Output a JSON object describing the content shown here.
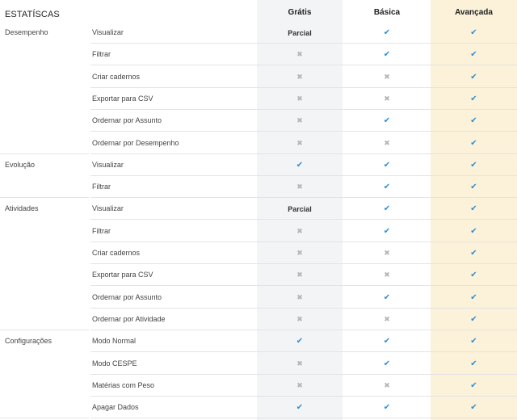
{
  "header": {
    "title": "ESTATÍSCAS",
    "plans": [
      "Grátis",
      "Básica",
      "Avançada"
    ]
  },
  "colors": {
    "check": "#2b8fd6",
    "cross": "#b5b5b5",
    "gratis_bg": "#f3f4f6",
    "avancada_bg": "#fcf1d9"
  },
  "icons": {
    "yes": "checkmark-icon",
    "no": "cross-icon"
  },
  "rows": [
    {
      "category": "Desempenho",
      "feature": "Visualizar",
      "values": [
        "Parcial",
        "yes",
        "yes"
      ]
    },
    {
      "category": "",
      "feature": "Filtrar",
      "values": [
        "no",
        "yes",
        "yes"
      ]
    },
    {
      "category": "",
      "feature": "Criar cadernos",
      "values": [
        "no",
        "no",
        "yes"
      ]
    },
    {
      "category": "",
      "feature": "Exportar para CSV",
      "values": [
        "no",
        "no",
        "yes"
      ]
    },
    {
      "category": "",
      "feature": "Ordernar por Assunto",
      "values": [
        "no",
        "yes",
        "yes"
      ]
    },
    {
      "category": "",
      "feature": "Ordernar por Desempenho",
      "values": [
        "no",
        "no",
        "yes"
      ]
    },
    {
      "category": "Evolução",
      "feature": "Visualizar",
      "values": [
        "yes",
        "yes",
        "yes"
      ]
    },
    {
      "category": "",
      "feature": "Filtrar",
      "values": [
        "no",
        "yes",
        "yes"
      ]
    },
    {
      "category": "Atividades",
      "feature": "Visualizar",
      "values": [
        "Parcial",
        "yes",
        "yes"
      ]
    },
    {
      "category": "",
      "feature": "Filtrar",
      "values": [
        "no",
        "yes",
        "yes"
      ]
    },
    {
      "category": "",
      "feature": "Criar cadernos",
      "values": [
        "no",
        "no",
        "yes"
      ]
    },
    {
      "category": "",
      "feature": "Exportar para CSV",
      "values": [
        "no",
        "no",
        "yes"
      ]
    },
    {
      "category": "",
      "feature": "Ordernar por Assunto",
      "values": [
        "no",
        "yes",
        "yes"
      ]
    },
    {
      "category": "",
      "feature": "Ordernar por Atividade",
      "values": [
        "no",
        "no",
        "yes"
      ]
    },
    {
      "category": "Configurações",
      "feature": "Modo Normal",
      "values": [
        "yes",
        "yes",
        "yes"
      ]
    },
    {
      "category": "",
      "feature": "Modo CESPE",
      "values": [
        "no",
        "yes",
        "yes"
      ]
    },
    {
      "category": "",
      "feature": "Matérias com Peso",
      "values": [
        "no",
        "no",
        "yes"
      ]
    },
    {
      "category": "",
      "feature": "Apagar Dados",
      "values": [
        "yes",
        "yes",
        "yes"
      ]
    }
  ]
}
